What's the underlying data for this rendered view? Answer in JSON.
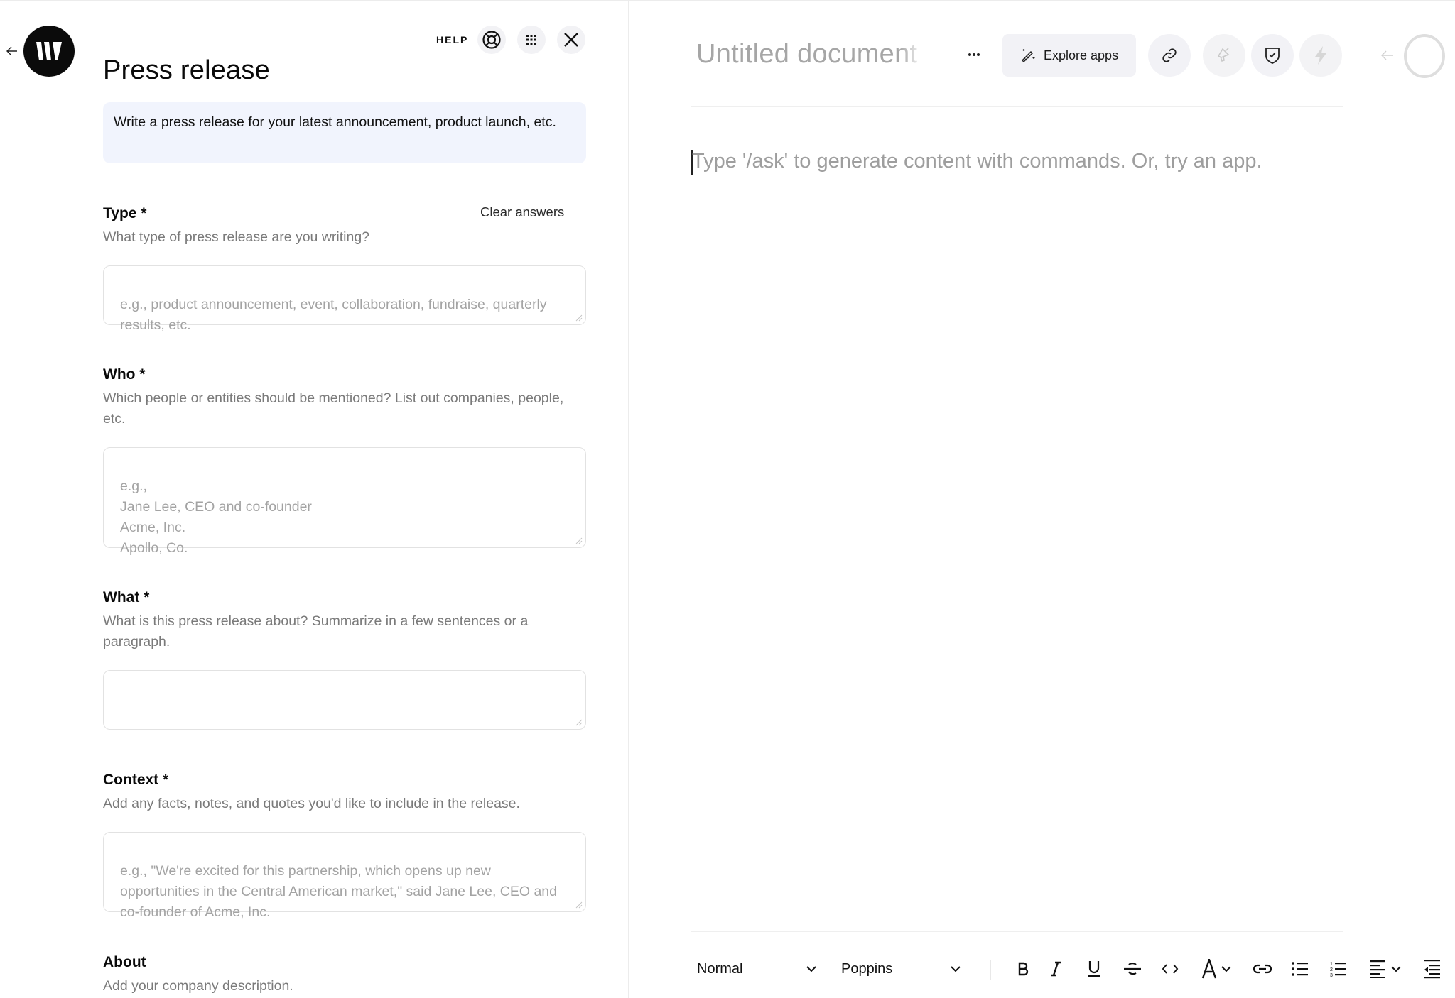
{
  "left_panel": {
    "back_icon": "arrow-left-icon",
    "logo": "W",
    "help_label": "HELP",
    "help_icons": [
      "lifebuoy-icon",
      "grid-dots-icon",
      "close-icon"
    ],
    "title": "Press release",
    "description": "Write a press release for your latest announcement, product launch, etc.",
    "clear_answers": "Clear answers",
    "fields": [
      {
        "label": "Type *",
        "help": "What type of press release are you writing?",
        "placeholder": "e.g., product announcement, event, collaboration, fundraise, quarterly results, etc.",
        "value": ""
      },
      {
        "label": "Who *",
        "help": "Which people or entities should be mentioned? List out companies, people, etc.",
        "placeholder": "e.g.,\nJane Lee, CEO and co-founder\nAcme, Inc.\nApollo, Co.",
        "value": ""
      },
      {
        "label": "What *",
        "help": "What is this press release about? Summarize in a few sentences or a paragraph.",
        "placeholder": "",
        "value": ""
      },
      {
        "label": "Context *",
        "help": "Add any facts, notes, and quotes you'd like to include in the release.",
        "placeholder": "e.g., \"We're excited for this partnership, which opens up new opportunities in the Central American market,\" said Jane Lee, CEO and co-founder of Acme, Inc.",
        "value": ""
      },
      {
        "label": "About",
        "help": "Add your company description."
      }
    ]
  },
  "editor": {
    "doc_title": "Untitled document",
    "more_icon": "more-horizontal-icon",
    "explore_apps_label": "Explore apps",
    "explore_apps_icon": "magic-wand-icon",
    "header_icons": [
      {
        "name": "link-icon",
        "enabled": true
      },
      {
        "name": "megaphone-icon",
        "enabled": false
      },
      {
        "name": "shield-check-icon",
        "enabled": true
      },
      {
        "name": "lightning-icon",
        "enabled": false
      }
    ],
    "placeholder": "Type '/ask' to generate content with commands. Or, try an app.",
    "toolbar": {
      "paragraph_style": "Normal",
      "font_family": "Poppins",
      "buttons": [
        "bold",
        "italic",
        "underline",
        "strikethrough",
        "code",
        "text-color",
        "link",
        "bullet-list",
        "numbered-list",
        "align",
        "outdent"
      ]
    }
  },
  "colors": {
    "logo_bg": "#0b0b0b",
    "description_bg": "#f1f4fd",
    "button_bg": "#f2f2f6",
    "placeholder_text": "#9e9e9e"
  }
}
